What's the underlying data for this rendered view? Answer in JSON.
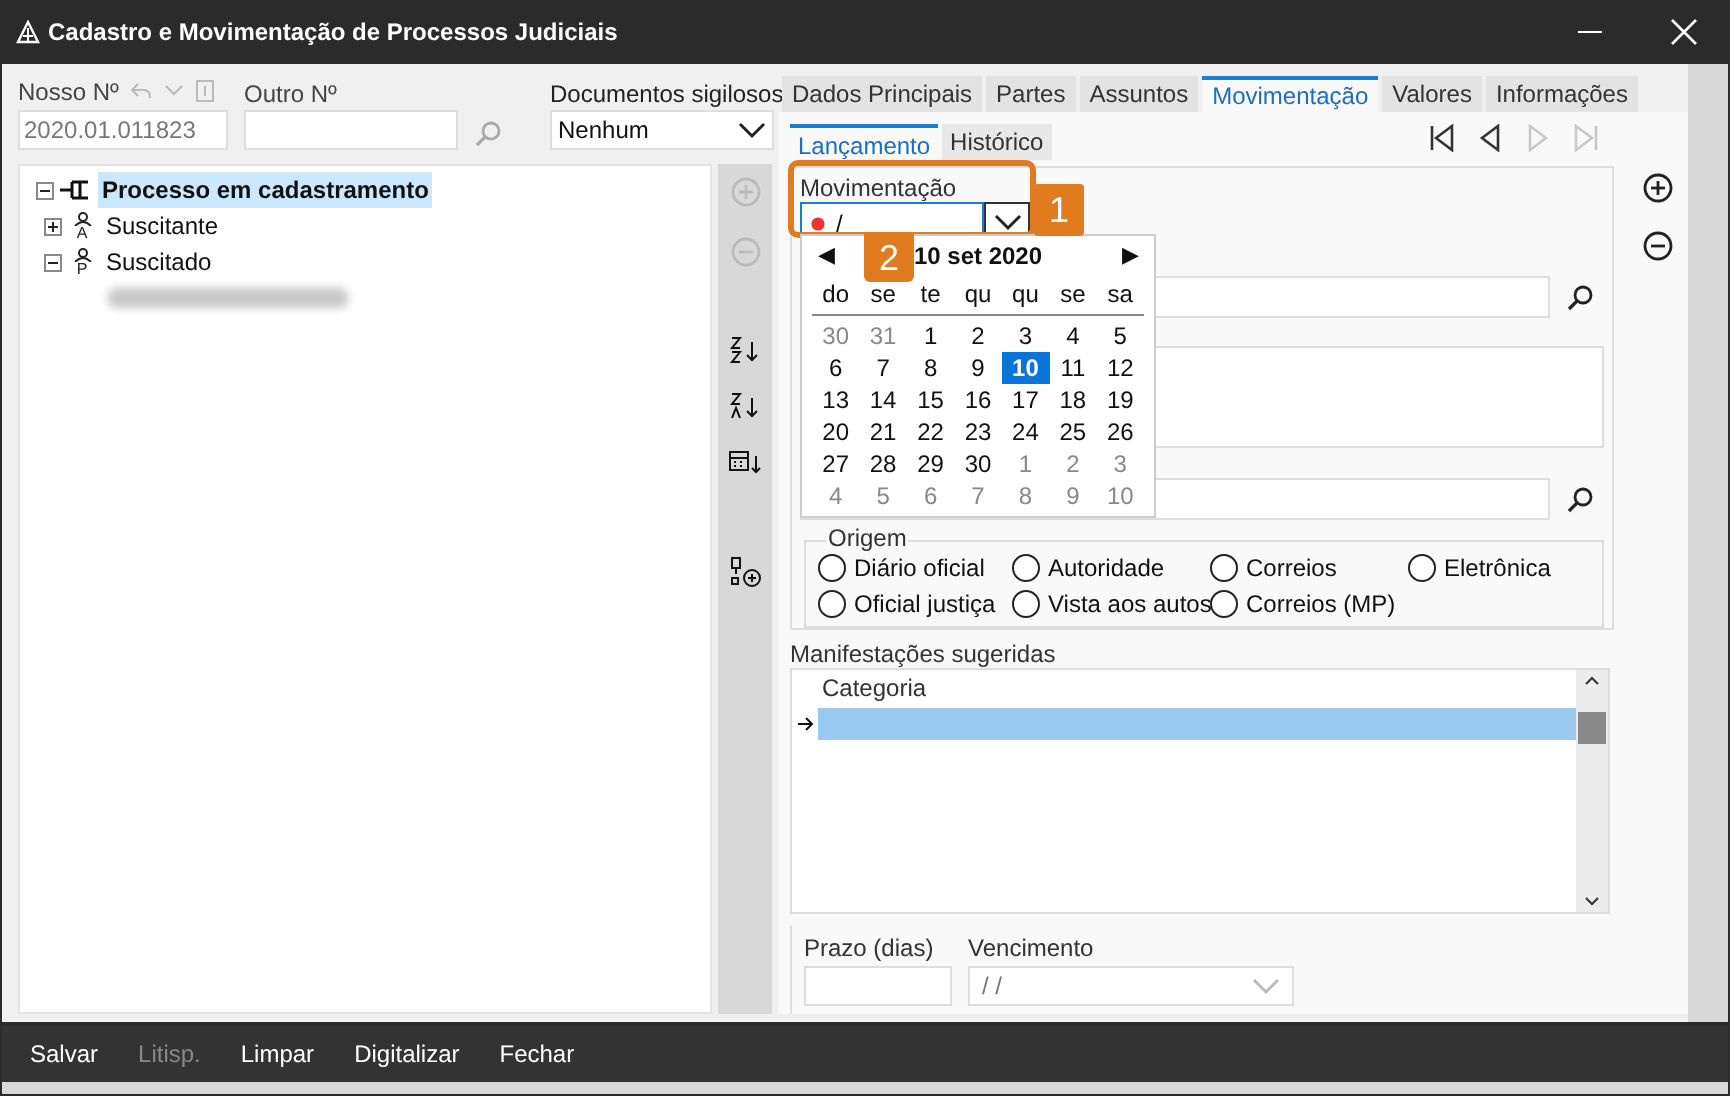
{
  "window": {
    "title": "Cadastro e Movimentação de Processos Judiciais"
  },
  "header": {
    "nosso_label": "Nosso Nº",
    "nosso_value": "2020.01.011823",
    "outro_label": "Outro Nº",
    "docs_label": "Documentos sigilosos",
    "docs_value": "Nenhum"
  },
  "tree": {
    "label": "Processo em cadastramento",
    "expanded": true,
    "selected": true,
    "children": [
      {
        "label": "Suscitante",
        "role": "A",
        "expanded": false
      },
      {
        "label": "Suscitado",
        "role": "P",
        "expanded": true,
        "children": [
          {
            "kind": "blurred"
          }
        ]
      }
    ]
  },
  "tabs": [
    {
      "label": "Dados Principais",
      "selected": false
    },
    {
      "label": "Partes",
      "selected": false
    },
    {
      "label": "Assuntos",
      "selected": false
    },
    {
      "label": "Movimentação",
      "selected": true
    },
    {
      "label": "Valores",
      "selected": false
    },
    {
      "label": "Informações",
      "selected": false
    }
  ],
  "subtabs": [
    {
      "label": "Lançamento",
      "selected": true
    },
    {
      "label": "Histórico",
      "selected": false
    }
  ],
  "nav": [
    {
      "kind": "first",
      "disabled": false
    },
    {
      "kind": "prev",
      "disabled": false
    },
    {
      "kind": "next",
      "disabled": true
    },
    {
      "kind": "last",
      "disabled": true
    }
  ],
  "movimentacao": {
    "label": "Movimentação",
    "value": "/"
  },
  "callouts": [
    "1",
    "2"
  ],
  "calendar": {
    "title": "10 set 2020",
    "prev": "◀",
    "next": "▶",
    "weekdays": [
      "do",
      "se",
      "te",
      "qu",
      "qu",
      "se",
      "sa"
    ],
    "days": [
      {
        "d": "30",
        "outside": true,
        "selected": false
      },
      {
        "d": "31",
        "outside": true,
        "selected": false
      },
      {
        "d": "1",
        "outside": false,
        "selected": false
      },
      {
        "d": "2",
        "outside": false,
        "selected": false
      },
      {
        "d": "3",
        "outside": false,
        "selected": false
      },
      {
        "d": "4",
        "outside": false,
        "selected": false
      },
      {
        "d": "5",
        "outside": false,
        "selected": false
      },
      {
        "d": "6",
        "outside": false,
        "selected": false
      },
      {
        "d": "7",
        "outside": false,
        "selected": false
      },
      {
        "d": "8",
        "outside": false,
        "selected": false
      },
      {
        "d": "9",
        "outside": false,
        "selected": false
      },
      {
        "d": "10",
        "outside": false,
        "selected": true
      },
      {
        "d": "11",
        "outside": false,
        "selected": false
      },
      {
        "d": "12",
        "outside": false,
        "selected": false
      },
      {
        "d": "13",
        "outside": false,
        "selected": false
      },
      {
        "d": "14",
        "outside": false,
        "selected": false
      },
      {
        "d": "15",
        "outside": false,
        "selected": false
      },
      {
        "d": "16",
        "outside": false,
        "selected": false
      },
      {
        "d": "17",
        "outside": false,
        "selected": false
      },
      {
        "d": "18",
        "outside": false,
        "selected": false
      },
      {
        "d": "19",
        "outside": false,
        "selected": false
      },
      {
        "d": "20",
        "outside": false,
        "selected": false
      },
      {
        "d": "21",
        "outside": false,
        "selected": false
      },
      {
        "d": "22",
        "outside": false,
        "selected": false
      },
      {
        "d": "23",
        "outside": false,
        "selected": false
      },
      {
        "d": "24",
        "outside": false,
        "selected": false
      },
      {
        "d": "25",
        "outside": false,
        "selected": false
      },
      {
        "d": "26",
        "outside": false,
        "selected": false
      },
      {
        "d": "27",
        "outside": false,
        "selected": false
      },
      {
        "d": "28",
        "outside": false,
        "selected": false
      },
      {
        "d": "29",
        "outside": false,
        "selected": false
      },
      {
        "d": "30",
        "outside": false,
        "selected": false
      },
      {
        "d": "1",
        "outside": true,
        "selected": false
      },
      {
        "d": "2",
        "outside": true,
        "selected": false
      },
      {
        "d": "3",
        "outside": true,
        "selected": false
      },
      {
        "d": "4",
        "outside": true,
        "selected": false
      },
      {
        "d": "5",
        "outside": true,
        "selected": false
      },
      {
        "d": "6",
        "outside": true,
        "selected": false
      },
      {
        "d": "7",
        "outside": true,
        "selected": false
      },
      {
        "d": "8",
        "outside": true,
        "selected": false
      },
      {
        "d": "9",
        "outside": true,
        "selected": false
      },
      {
        "d": "10",
        "outside": true,
        "selected": false
      }
    ]
  },
  "origem": {
    "label": "Origem",
    "options": [
      {
        "label": "Diário oficial",
        "selected": false
      },
      {
        "label": "Autoridade",
        "selected": false
      },
      {
        "label": "Correios",
        "selected": false
      },
      {
        "label": "Eletrônica",
        "selected": false
      },
      {
        "label": "Oficial justiça",
        "selected": false
      },
      {
        "label": "Vista aos autos",
        "selected": false
      },
      {
        "label": "Correios (MP)",
        "selected": false
      }
    ]
  },
  "manifestacoes": {
    "label": "Manifestações sugeridas",
    "column": "Categoria",
    "rows": [
      {
        "selected": true
      }
    ]
  },
  "prazo": {
    "label": "Prazo (dias)"
  },
  "vencimento": {
    "label": "Vencimento",
    "value": "/ /"
  },
  "footer": [
    {
      "label": "Salvar",
      "disabled": false
    },
    {
      "label": "Litisp.",
      "disabled": true
    },
    {
      "label": "Limpar",
      "disabled": false
    },
    {
      "label": "Digitalizar",
      "disabled": false
    },
    {
      "label": "Fechar",
      "disabled": false
    }
  ]
}
